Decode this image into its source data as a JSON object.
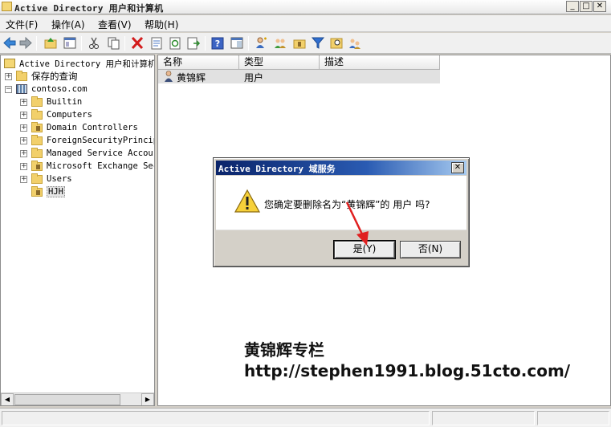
{
  "window": {
    "title": "Active Directory 用户和计算机"
  },
  "menu": [
    "文件(F)",
    "操作(A)",
    "查看(V)",
    "帮助(H)"
  ],
  "toolbar": {
    "buttons": [
      "back-icon",
      "forward-icon",
      "up-folder-icon",
      "show-tree-icon",
      "cut-icon",
      "copy-icon",
      "delete-icon",
      "properties-icon",
      "refresh-icon",
      "export-icon",
      "help-icon",
      "console-icon",
      "new-user-icon",
      "new-group-icon",
      "new-ou-icon",
      "filter-icon",
      "find-icon",
      "add-to-group-icon"
    ]
  },
  "tree": {
    "root": "Active Directory 用户和计算机",
    "saved_queries": "保存的查询",
    "domain": "contoso.com",
    "children": [
      "Builtin",
      "Computers",
      "Domain Controllers",
      "ForeignSecurityPrincip",
      "Managed Service Accour",
      "Microsoft Exchange Sec",
      "Users",
      "HJH"
    ]
  },
  "list": {
    "columns": [
      "名称",
      "类型",
      "描述"
    ],
    "rows": [
      {
        "name": "黄锦辉",
        "type": "用户",
        "description": ""
      }
    ]
  },
  "dialog": {
    "title": "Active Directory 域服务",
    "message": "您确定要删除名为“黄锦辉”的 用户 吗?",
    "yes_label": "是(Y)",
    "no_label": "否(N)",
    "close_glyph": "✕"
  },
  "watermark": {
    "line1": "黄锦辉专栏",
    "line2": "http://stephen1991.blog.51cto.com/"
  },
  "colors": {
    "dialog_title_start": "#0a246a",
    "dialog_title_end": "#a6caf0",
    "annotation_arrow": "#e02020",
    "folder": "#f2d06b"
  }
}
